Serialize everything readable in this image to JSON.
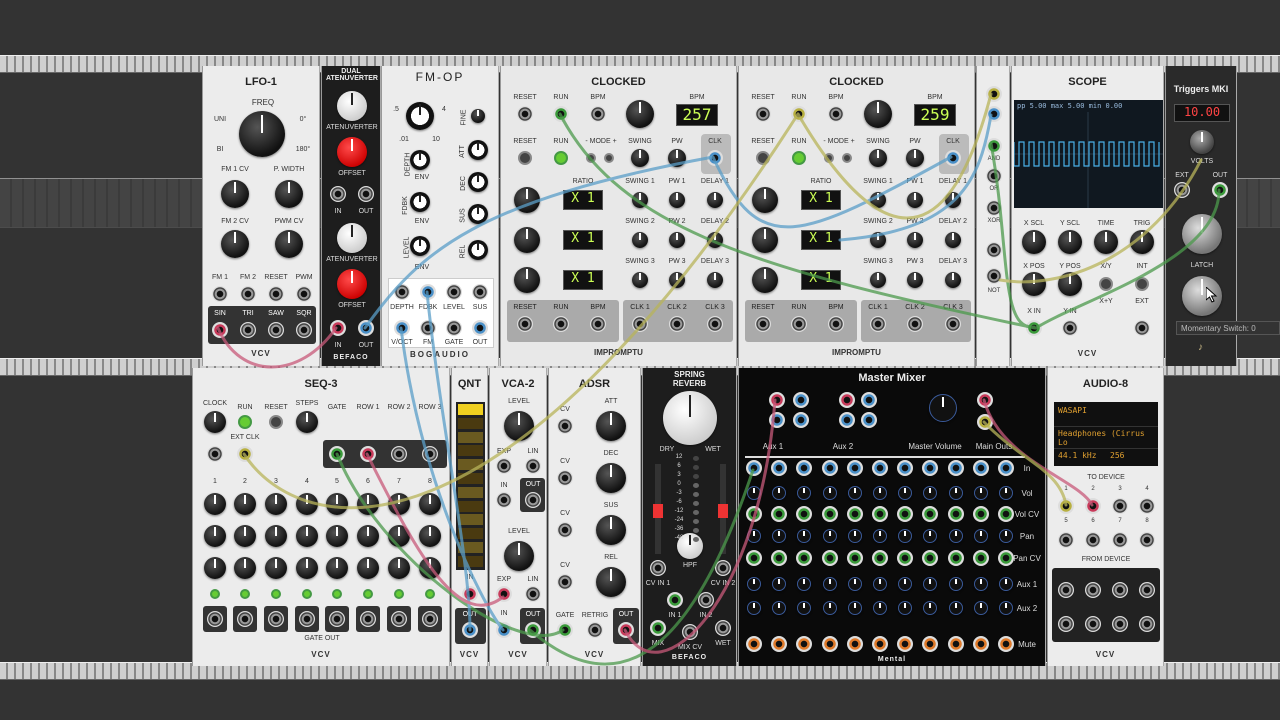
{
  "modules": {
    "lfo": {
      "title": "LFO-1",
      "freq": "FREQ",
      "uni": "UNI",
      "bi": "BI",
      "deg0": "0°",
      "deg180": "180°",
      "fm1cv": "FM 1 CV",
      "pwidth": "P. WIDTH",
      "fm2cv": "FM 2 CV",
      "pwmcv": "PWM CV",
      "jacks1": [
        "FM 1",
        "FM 2",
        "RESET",
        "PWM"
      ],
      "outs": [
        "SIN",
        "TRI",
        "SAW",
        "SQR"
      ],
      "brand": "VCV"
    },
    "dual": {
      "title": "DUAL ATENUVERTER",
      "aten": "ATENUVERTER",
      "offset": "OFFSET",
      "in": "IN",
      "out": "OUT",
      "brand": "BEFACO"
    },
    "fmop": {
      "title": "FM-OP",
      "fine": "FINE",
      "att": "ATT",
      "dec": "DEC",
      "sus": "SUS",
      "rel": "REL",
      "depth": "DEPTH",
      "fdbk": "FDBK",
      "level": "LEVEL",
      "env": "ENV",
      "jacks1": [
        "DEPTH",
        "FDBK",
        "LEVEL",
        "SUS"
      ],
      "jacks2": [
        "V/OCT",
        "FM",
        "GATE",
        "OUT"
      ],
      "brand": "BOGAUDIO",
      "scale": [
        ".5",
        "1",
        "2",
        "4",
        "5",
        ".01",
        "10"
      ]
    },
    "clocked1": {
      "title": "CLOCKED",
      "reset": "RESET",
      "run": "RUN",
      "bpm": "BPM",
      "bpm_val": "257",
      "mode": "- MODE +",
      "swing": "SWING",
      "pw": "PW",
      "clk": "CLK",
      "ratio": "RATIO",
      "swings": [
        "SWING 1",
        "SWING 2",
        "SWING 3"
      ],
      "pws": [
        "PW 1",
        "PW 2",
        "PW 3"
      ],
      "delays": [
        "DELAY 1",
        "DELAY 2",
        "DELAY 3"
      ],
      "outs": [
        "RESET",
        "RUN",
        "BPM",
        "CLK 1",
        "CLK 2",
        "CLK 3"
      ],
      "ratio_vals": [
        "X 1",
        "X 1",
        "X 1"
      ],
      "brand": "IMPROMPTU"
    },
    "clocked2": {
      "title": "CLOCKED",
      "reset": "RESET",
      "run": "RUN",
      "bpm": "BPM",
      "bpm_val": "259",
      "mode": "- MODE +",
      "swing": "SWING",
      "pw": "PW",
      "clk": "CLK",
      "ratio": "RATIO",
      "swings": [
        "SWING 1",
        "SWING 2",
        "SWING 3"
      ],
      "pws": [
        "PW 1",
        "PW 2",
        "PW 3"
      ],
      "delays": [
        "DELAY 1",
        "DELAY 2",
        "DELAY 3"
      ],
      "outs": [
        "RESET",
        "RUN",
        "BPM",
        "CLK 1",
        "CLK 2",
        "CLK 3"
      ],
      "ratio_vals": [
        "X 1",
        "X 1",
        "X 1"
      ],
      "brand": "IMPROMPTU"
    },
    "logic": {
      "labels": [
        "AND",
        "OR",
        "XOR",
        "NOT"
      ]
    },
    "scope": {
      "title": "SCOPE",
      "readout": "pp  5.00  max  5.00  min  0.00",
      "xscl": "X SCL",
      "yscl": "Y SCL",
      "time": "TIME",
      "trig": "TRIG",
      "xpos": "X POS",
      "ypos": "Y POS",
      "xy": "X/Y",
      "xpy": "X+Y",
      "int": "INT",
      "ext": "EXT",
      "xin": "X IN",
      "yin": "Y IN",
      "brand": "VCV"
    },
    "triggers": {
      "title": "Triggers MKI",
      "display": "10.00",
      "volts": "VOLTS",
      "ext": "EXT",
      "out": "OUT",
      "latch": "LATCH",
      "tooltip": "Momentary Switch: 0"
    },
    "seq3": {
      "title": "SEQ-3",
      "clock": "CLOCK",
      "run": "RUN",
      "reset": "RESET",
      "steps": "STEPS",
      "gate": "GATE",
      "row1": "ROW 1",
      "row2": "ROW 2",
      "row3": "ROW 3",
      "extclk": "EXT CLK",
      "cols": [
        "1",
        "2",
        "3",
        "4",
        "5",
        "6",
        "7",
        "8"
      ],
      "gateout": "GATE OUT",
      "brand": "VCV"
    },
    "qnt": {
      "title": "QNT",
      "in": "IN",
      "out": "OUT",
      "brand": "VCV"
    },
    "vca2": {
      "title": "VCA-2",
      "level": "LEVEL",
      "exp": "EXP",
      "lin": "LIN",
      "in": "IN",
      "out": "OUT",
      "brand": "VCV"
    },
    "adsr": {
      "title": "ADSR",
      "att": "ATT",
      "dec": "DEC",
      "sus": "SUS",
      "rel": "REL",
      "cv": "CV",
      "gate": "GATE",
      "retrig": "RETRIG",
      "out": "OUT",
      "brand": "VCV"
    },
    "reverb": {
      "title": "SPRING REVERB",
      "dry": "DRY",
      "wet": "WET",
      "in1": "IN 1",
      "in2": "IN 2",
      "cvin1": "CV IN 1",
      "cvin2": "CV IN 2",
      "hpf": "HPF",
      "mix": "MIX",
      "mixcv": "MIX CV",
      "brand": "BEFACO",
      "db": [
        "12",
        "6",
        "3",
        "0",
        "-3",
        "-6",
        "-12",
        "-24",
        "-36",
        "-48"
      ]
    },
    "mixer": {
      "title": "Master Mixer",
      "aux1": "Aux 1",
      "aux2": "Aux 2",
      "master": "Master Volume",
      "mainouts": "Main Outs",
      "rows": [
        "In",
        "Vol",
        "Vol CV",
        "Pan",
        "Pan CV",
        "Aux 1",
        "Aux 2",
        "Mute"
      ],
      "brand": "Mental"
    },
    "audio8": {
      "title": "AUDIO-8",
      "driver": "WASAPI",
      "device": "Headphones (Cirrus Lo",
      "rate": "44.1 kHz",
      "buffer": "256",
      "todevice": "TO DEVICE",
      "fromdevice": "FROM DEVICE",
      "nums": [
        "1",
        "2",
        "3",
        "4",
        "5",
        "6",
        "7",
        "8"
      ],
      "brand": "VCV"
    }
  },
  "colors": {
    "cable_green": "#4c9a4c",
    "cable_blue": "#5a9ec8",
    "cable_pink": "#c85a7a",
    "cable_yellow": "#b8b45a",
    "rail": "#c8c8c8",
    "lcd": "#cfef55"
  }
}
